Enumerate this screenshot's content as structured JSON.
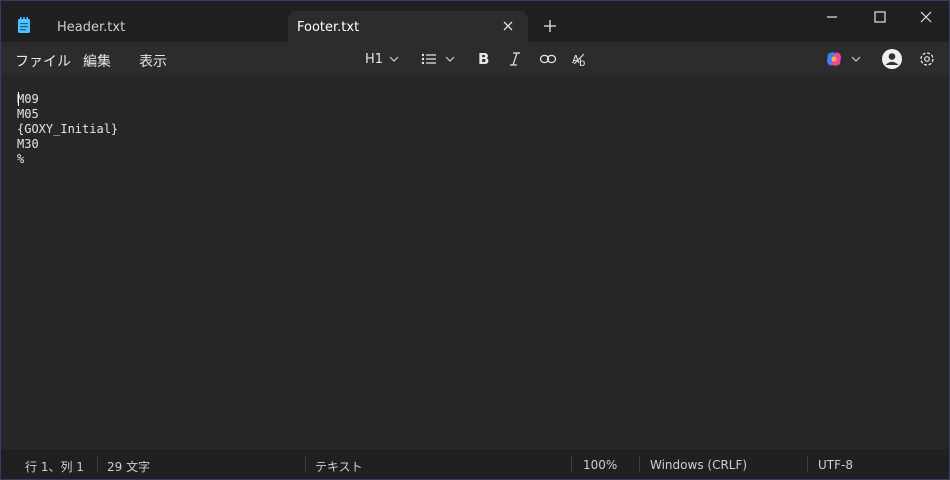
{
  "tabs": [
    {
      "label": "Header.txt",
      "active": false
    },
    {
      "label": "Footer.txt",
      "active": true
    }
  ],
  "menu": {
    "file": "ファイル",
    "edit": "編集",
    "view": "表示"
  },
  "toolbar": {
    "heading": "H1"
  },
  "editor": {
    "lines": [
      "M09",
      "M05",
      "{GOXY_Initial}",
      "M30",
      "%"
    ]
  },
  "status": {
    "position": "行 1、列 1",
    "char_count": "29 文字",
    "format": "テキスト",
    "zoom": "100%",
    "line_ending": "Windows (CRLF)",
    "encoding": "UTF-8"
  },
  "colors": {
    "accent": "#4cc2ff",
    "background": "#202020",
    "editor_bg": "#272727"
  }
}
